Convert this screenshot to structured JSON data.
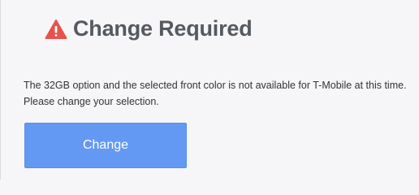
{
  "dialog": {
    "title": "Change Required",
    "icon": "warning-triangle-icon",
    "icon_color": "#e8524c",
    "message_line1": "The 32GB option and the selected front color is not available for T-Mobile at this time.",
    "message_line2": "Please change your selection.",
    "button_label": "Change",
    "button_color": "#6399f2"
  }
}
